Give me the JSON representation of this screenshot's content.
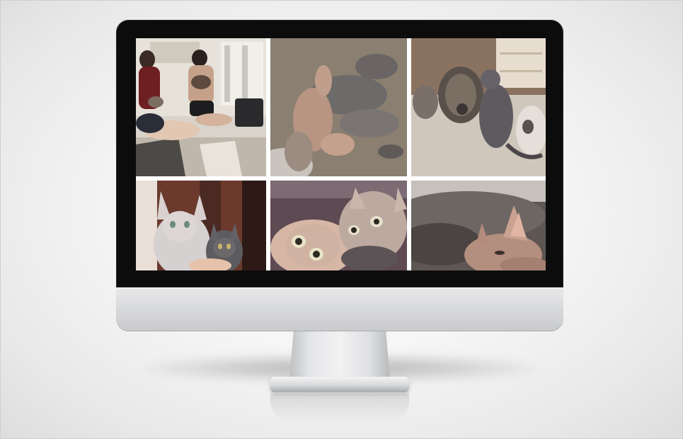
{
  "scene": {
    "description_type": "photo-mockup",
    "device": "desktop-monitor",
    "background_color": "#f2f2f2",
    "bezel_color": "#0c0c0c",
    "chin_color": "#d6d7d9"
  },
  "screen": {
    "content": "photo-grid",
    "rows": 2,
    "columns": 3,
    "tiles": [
      {
        "subject": "two-people-holding-kittens",
        "dominant_color": "#6b5b4e"
      },
      {
        "subject": "sleeping-hairless-kittens",
        "dominant_color": "#8a7a6a"
      },
      {
        "subject": "hairless-cats-playing-with-scratcher",
        "dominant_color": "#b7ada2"
      },
      {
        "subject": "two-hairless-cats-portrait",
        "dominant_color": "#6a3f34"
      },
      {
        "subject": "hairless-cats-looking-up",
        "dominant_color": "#a9948a"
      },
      {
        "subject": "hairless-cat-lying-closeup",
        "dominant_color": "#5d5450"
      }
    ]
  }
}
